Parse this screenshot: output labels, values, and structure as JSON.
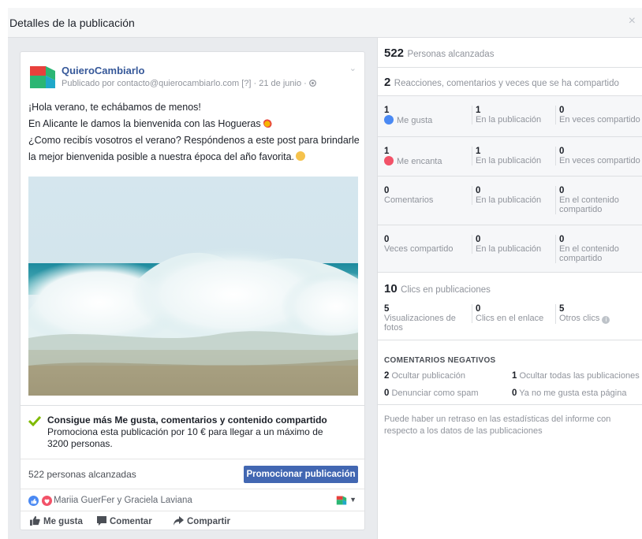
{
  "dialog": {
    "title": "Detalles de la publicación",
    "close": "×"
  },
  "post": {
    "page_name": "QuieroCambiarlo",
    "meta": "Publicado por contacto@quierocambiarlo.com [?] · 21 de junio · ",
    "lines": [
      "¡Hola verano, te echábamos de menos!",
      "En Alicante le damos la bienvenida con las Hogueras",
      "¿Como recibís vosotros el verano? Respóndenos a este post para brindarle la mejor bienvenida posible a nuestra época del año favorita."
    ]
  },
  "promo": {
    "title": "Consigue más Me gusta, comentarios y contenido compartido",
    "desc": "Promociona esta publicación por 10 € para llegar a un máximo de 3200 personas."
  },
  "reach_bar": {
    "text": "522 personas alcanzadas",
    "button": "Promocionar publicación"
  },
  "reactions_line": {
    "names": "Mariia GuerFer y Graciela Laviana"
  },
  "actions": {
    "like": "Me gusta",
    "comment": "Comentar",
    "share": "Compartir"
  },
  "stats": {
    "reach": {
      "num": "522",
      "label": "Personas alcanzadas"
    },
    "interactions": {
      "num": "2",
      "label": "Reacciones, comentarios y veces que se ha compartido"
    },
    "rows": [
      {
        "c1": {
          "n": "1",
          "l": "Me gusta"
        },
        "c2": {
          "n": "1",
          "l": "En la publicación"
        },
        "c3": {
          "n": "0",
          "l": "En veces compartido"
        }
      },
      {
        "c1": {
          "n": "1",
          "l": "Me encanta"
        },
        "c2": {
          "n": "1",
          "l": "En la publicación"
        },
        "c3": {
          "n": "0",
          "l": "En veces compartido"
        }
      },
      {
        "c1": {
          "n": "0",
          "l": "Comentarios"
        },
        "c2": {
          "n": "0",
          "l": "En la publicación"
        },
        "c3": {
          "n": "0",
          "l": "En el contenido compartido"
        }
      },
      {
        "c1": {
          "n": "0",
          "l": "Veces compartido"
        },
        "c2": {
          "n": "0",
          "l": "En la publicación"
        },
        "c3": {
          "n": "0",
          "l": "En el contenido compartido"
        }
      }
    ],
    "clicks": {
      "num": "10",
      "label": "Clics en publicaciones",
      "c1": {
        "n": "5",
        "l": "Visualizaciones de fotos"
      },
      "c2": {
        "n": "0",
        "l": "Clics en el enlace"
      },
      "c3": {
        "n": "5",
        "l": "Otros clics"
      }
    },
    "negative": {
      "title": "COMENTARIOS NEGATIVOS",
      "hide_post": {
        "n": "2",
        "l": "Ocultar publicación"
      },
      "hide_all": {
        "n": "1",
        "l": "Ocultar todas las publicaciones"
      },
      "spam": {
        "n": "0",
        "l": "Denunciar como spam"
      },
      "unlike": {
        "n": "0",
        "l": "Ya no me gusta esta página"
      }
    },
    "footnote": "Puede haber un retraso en las estadísticas del informe con respecto a los datos de las publicaciones"
  },
  "colors": {
    "brand_blue": "#4267b2",
    "link_blue": "#365899",
    "like_blue": "#4a89f3",
    "love_red": "#f25268",
    "check_green": "#7fba00"
  }
}
